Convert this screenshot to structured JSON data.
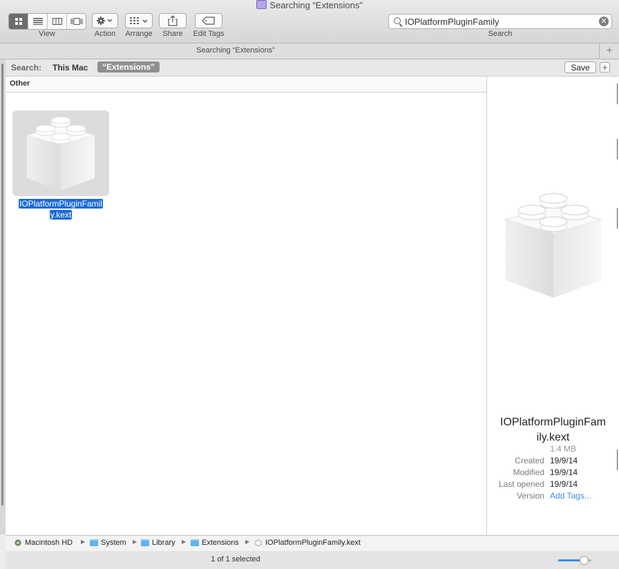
{
  "window": {
    "title": "Searching “Extensions”"
  },
  "toolbar": {
    "view_label": "View",
    "action_label": "Action",
    "arrange_label": "Arrange",
    "share_label": "Share",
    "edit_tags_label": "Edit Tags",
    "search_label": "Search",
    "active_view": "icon-view"
  },
  "search": {
    "value": "IOPlatformPluginFamily"
  },
  "tab": {
    "title": "Searching “Extensions”"
  },
  "scope": {
    "label": "Search:",
    "this_mac": "This Mac",
    "selected": "“Extensions”",
    "save_label": "Save"
  },
  "results": {
    "group_header": "Other",
    "items": [
      {
        "name_line1": "IOPlatformPluginFamil",
        "name_line2": "y.kext",
        "icon": "kext-lego-icon",
        "selected": true
      }
    ]
  },
  "preview": {
    "name_line1": "IOPlatformPluginFam",
    "name_line2": "ily.kext",
    "size": "1.4 MB",
    "rows": [
      {
        "key": "Created",
        "value": "19/9/14"
      },
      {
        "key": "Modified",
        "value": "19/9/14"
      },
      {
        "key": "Last opened",
        "value": "19/9/14"
      },
      {
        "key": "Version",
        "value": "Add Tags..."
      }
    ]
  },
  "path": [
    "Macintosh HD",
    "System",
    "Library",
    "Extensions",
    "IOPlatformPluginFamily.kext"
  ],
  "status": {
    "text": "1 of 1 selected",
    "icon_size_fraction": 0.78
  },
  "colors": {
    "selection": "#1b6ad8",
    "link": "#3a8ee6",
    "active_segment": "#6d6d6d"
  }
}
